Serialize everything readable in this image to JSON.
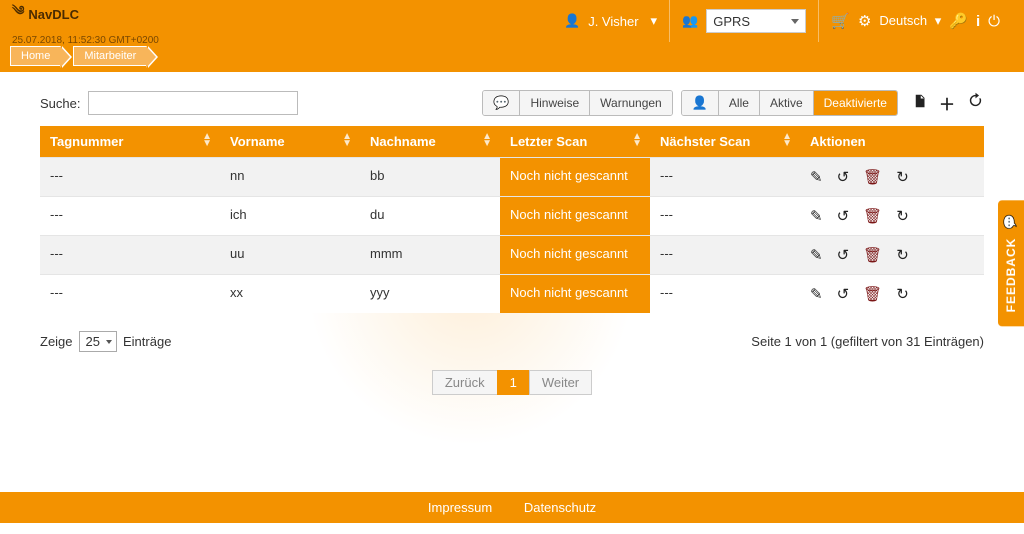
{
  "header": {
    "brand": "NavDLC",
    "timestamp": "25.07.2018, 11:52:30 GMT+0200",
    "user": "J. Visher",
    "connection_selected": "GPRS",
    "language": "Deutsch"
  },
  "breadcrumbs": [
    {
      "label": "Home"
    },
    {
      "label": "Mitarbeiter"
    }
  ],
  "toolbar": {
    "search_label": "Suche:",
    "search_value": "",
    "hints_label": "Hinweise",
    "warnings_label": "Warnungen",
    "all_label": "Alle",
    "active_label": "Aktive",
    "deactivated_label": "Deaktivierte"
  },
  "table": {
    "columns": {
      "tag": "Tagnummer",
      "first": "Vorname",
      "last": "Nachname",
      "last_scan": "Letzter Scan",
      "next_scan": "Nächster Scan",
      "actions": "Aktionen"
    },
    "rows": [
      {
        "tag": "---",
        "first": "nn",
        "last": "bb",
        "last_scan": "Noch nicht gescannt",
        "next_scan": "---"
      },
      {
        "tag": "---",
        "first": "ich",
        "last": "du",
        "last_scan": "Noch nicht gescannt",
        "next_scan": "---"
      },
      {
        "tag": "---",
        "first": "uu",
        "last": "mmm",
        "last_scan": "Noch nicht gescannt",
        "next_scan": "---"
      },
      {
        "tag": "---",
        "first": "xx",
        "last": "yyy",
        "last_scan": "Noch nicht gescannt",
        "next_scan": "---"
      }
    ]
  },
  "pagesize": {
    "show_label": "Zeige",
    "value": "25",
    "entries_label": "Einträge"
  },
  "pagination": {
    "status": "Seite 1 von 1 (gefiltert von 31 Einträgen)",
    "prev": "Zurück",
    "page": "1",
    "next": "Weiter"
  },
  "footer": {
    "imprint": "Impressum",
    "privacy": "Datenschutz"
  },
  "feedback": "FEEDBACK"
}
